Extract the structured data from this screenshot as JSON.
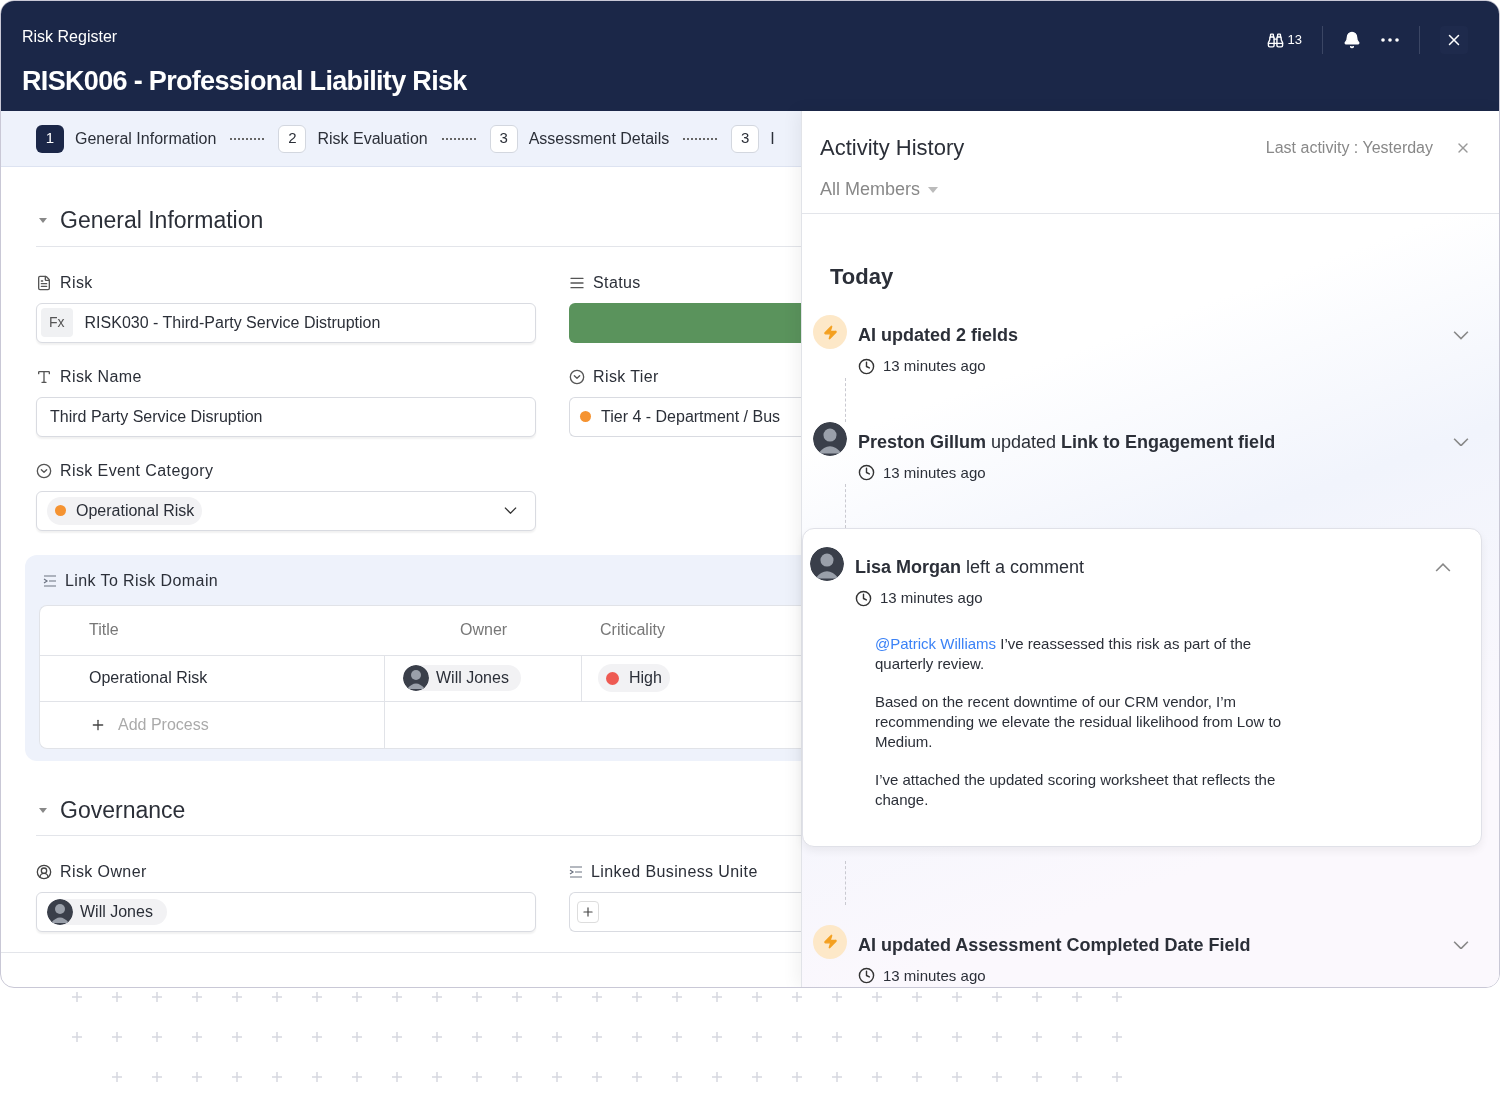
{
  "header": {
    "breadcrumb": "Risk Register",
    "title": "RISK006 - Professional Liability Risk",
    "watchers": "13"
  },
  "steps": [
    {
      "number": "1",
      "label": "General Information",
      "selected": true
    },
    {
      "number": "2",
      "label": "Risk Evaluation",
      "selected": false
    },
    {
      "number": "3",
      "label": "Assessment Details",
      "selected": false
    },
    {
      "number": "3",
      "label": "I",
      "selected": false
    }
  ],
  "general": {
    "heading": "General Information",
    "expanded": true,
    "risk": {
      "label": "Risk",
      "prefix": "Fx",
      "value": "RISK030 - Third-Party Service Distruption"
    },
    "status": {
      "label": "Status"
    },
    "risk_name": {
      "label": "Risk Name",
      "value": "Third Party Service Disruption"
    },
    "risk_tier": {
      "label": "Risk Tier",
      "value": "Tier 4 - Department / Bus",
      "color": "#f59331"
    },
    "risk_event_category": {
      "label": "Risk Event Category",
      "value": "Operational Risk",
      "color": "#f59331"
    }
  },
  "risk_domain": {
    "label": "Link To Risk Domain",
    "columns": [
      "Title",
      "Owner",
      "Criticality"
    ],
    "rows": [
      {
        "title": "Operational Risk",
        "owner": "Will Jones",
        "criticality": "High",
        "color": "#ee5a52"
      }
    ],
    "add_label": "Add Process"
  },
  "governance": {
    "heading": "Governance",
    "expanded": true,
    "risk_owner": {
      "label": "Risk Owner",
      "value": "Will Jones"
    },
    "linked_business_unit": {
      "label": "Linked Business Unite"
    }
  },
  "activity": {
    "title": "Activity History",
    "last_activity": "Last activity : Yesterday",
    "filter": "All Members",
    "group": "Today",
    "items": [
      {
        "kind": "ai",
        "title": "AI updated 2 fields",
        "time": "13 minutes ago",
        "expanded": false
      },
      {
        "kind": "user",
        "title": "**Preston Gillum** updated **Link to Engagement field**",
        "time": "13 minutes ago",
        "expanded": false
      },
      {
        "kind": "comment",
        "title": "**Lisa Morgan** left a comment",
        "time": "13 minutes ago",
        "expanded": true,
        "mention": "@Patrick Williams",
        "paragraphs": [
          "I’ve reassessed this risk as part of the quarterly review.",
          "Based on the recent downtime of our CRM vendor, I’m recommending we elevate the residual likelihood from Low to Medium.",
          "I’ve attached the updated scoring worksheet that reflects the change."
        ]
      },
      {
        "kind": "ai",
        "title": "AI updated Assessment Completed Date Field",
        "time": "13 minutes ago",
        "expanded": false
      }
    ]
  }
}
